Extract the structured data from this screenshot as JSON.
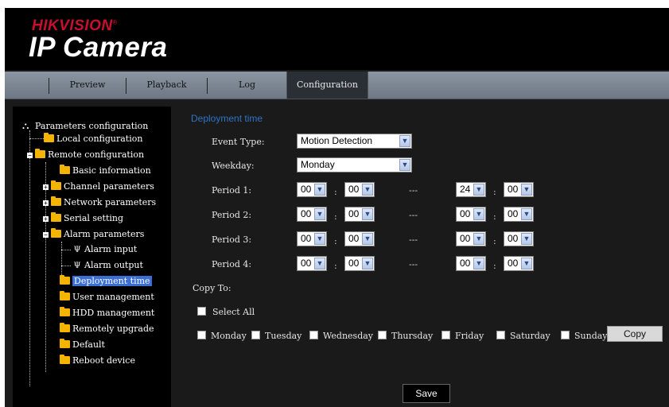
{
  "brand": {
    "company": "HIKVISION",
    "reg_mark": "®",
    "product": "IP Camera"
  },
  "nav": {
    "tabs": [
      {
        "label": "Preview"
      },
      {
        "label": "Playback"
      },
      {
        "label": "Log"
      },
      {
        "label": "Configuration",
        "active": true
      }
    ]
  },
  "sidebar": {
    "items": [
      {
        "label": "Parameters configuration",
        "type": "root"
      },
      {
        "label": "Local configuration",
        "type": "folder"
      },
      {
        "label": "Remote configuration",
        "type": "folder",
        "toggle": "−"
      },
      {
        "label": "Basic information",
        "type": "folder"
      },
      {
        "label": "Channel parameters",
        "type": "folder",
        "toggle": "+"
      },
      {
        "label": "Network parameters",
        "type": "folder",
        "toggle": "+"
      },
      {
        "label": "Serial setting",
        "type": "folder",
        "toggle": "+"
      },
      {
        "label": "Alarm parameters",
        "type": "folder",
        "toggle": "−"
      },
      {
        "label": "Alarm input",
        "type": "leaf"
      },
      {
        "label": "Alarm output",
        "type": "leaf"
      },
      {
        "label": "Deployment time",
        "type": "folder",
        "selected": true
      },
      {
        "label": "User management",
        "type": "folder"
      },
      {
        "label": "HDD management",
        "type": "folder"
      },
      {
        "label": "Remotely upgrade",
        "type": "folder"
      },
      {
        "label": "Default",
        "type": "folder"
      },
      {
        "label": "Reboot device",
        "type": "folder"
      }
    ]
  },
  "content": {
    "title": "Deployment time",
    "event_type": {
      "label": "Event Type:",
      "value": "Motion Detection"
    },
    "weekday": {
      "label": "Weekday:",
      "value": "Monday"
    },
    "periods": [
      {
        "label": "Period 1:",
        "start_h": "00",
        "start_m": "00",
        "end_h": "24",
        "end_m": "00"
      },
      {
        "label": "Period 2:",
        "start_h": "00",
        "start_m": "00",
        "end_h": "00",
        "end_m": "00"
      },
      {
        "label": "Period 3:",
        "start_h": "00",
        "start_m": "00",
        "end_h": "00",
        "end_m": "00"
      },
      {
        "label": "Period 4:",
        "start_h": "00",
        "start_m": "00",
        "end_h": "00",
        "end_m": "00"
      }
    ],
    "colon": ":",
    "dash": "---",
    "copy_to": "Copy To:",
    "select_all": "Select All",
    "days": [
      "Monday",
      "Tuesday",
      "Wednesday",
      "Thursday",
      "Friday",
      "Saturday",
      "Sunday"
    ],
    "copy_button": "Copy",
    "save_button": "Save"
  },
  "colors": {
    "brand_red": "#c8102e",
    "accent_blue": "#2d74c4",
    "selection_blue": "#3b6fd6",
    "folder_yellow": "#f4b400"
  }
}
